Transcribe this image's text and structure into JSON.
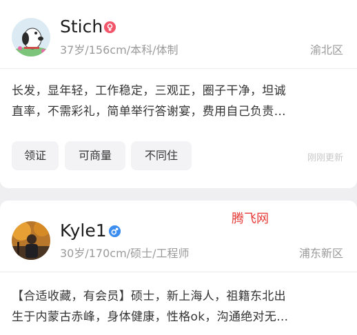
{
  "profiles": [
    {
      "name": "Stich",
      "gender_icon": "female",
      "meta": "37岁/156cm/本科/体制",
      "location": "渝北区",
      "description_lines": [
        "长发，显年轻，工作稳定，三观正，圈子干净，坦诚",
        "直率，不需彩礼，简单举行答谢宴，费用自己负责…"
      ],
      "tags": [
        "领证",
        "可商量",
        "不同住"
      ],
      "updated": "刚刚更新"
    },
    {
      "name": "Kyle1",
      "gender_icon": "male",
      "meta": "30岁/170cm/硕士/工程师",
      "location": "浦东新区",
      "description_lines": [
        "【合适收藏，有会员】硕士，新上海人，祖籍东北出",
        "生于内蒙古赤峰，身体健康，性格ok，沟通绝对无…"
      ]
    }
  ],
  "watermark": "腾飞网",
  "colors": {
    "female": "#f2566b",
    "male": "#3b8df0",
    "background": "#efeff1"
  }
}
